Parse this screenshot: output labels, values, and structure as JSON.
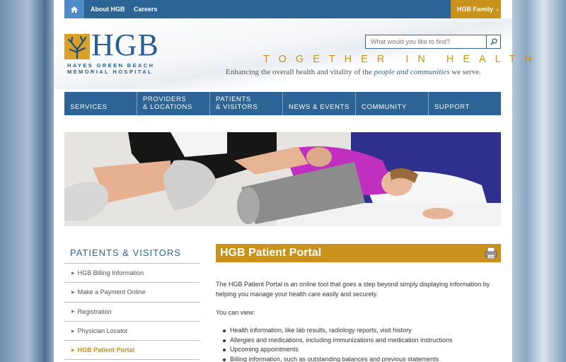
{
  "utility_nav": {
    "about": "About HGB",
    "careers": "Careers",
    "family": "HGB Family",
    "family_arrow": "›"
  },
  "logo": {
    "text": "HGB",
    "subline_1": "HAYES GREEN BEACH",
    "subline_2": "MEMORIAL HOSPITAL"
  },
  "search": {
    "placeholder": "What would you like to find?"
  },
  "tagline": "TOGETHER IN HEALTH",
  "subtagline": {
    "before": "Enhancing the overall health and vitality of the ",
    "emphasis": "people and communities",
    "after": " we serve."
  },
  "main_nav": [
    {
      "line1": "",
      "line2": "SERVICES"
    },
    {
      "line1": "PROVIDERS",
      "line2": "& LOCATIONS"
    },
    {
      "line1": "PATIENTS",
      "line2": "& VISITORS"
    },
    {
      "line1": "",
      "line2": "NEWS & EVENTS"
    },
    {
      "line1": "",
      "line2": "COMMUNITY"
    },
    {
      "line1": "",
      "line2": "SUPPORT"
    }
  ],
  "sidebar": {
    "title": "PATIENTS & VISITORS",
    "items": [
      {
        "label": "HGB Billing Information"
      },
      {
        "label": "Make a Payment Online"
      },
      {
        "label": "Registration"
      },
      {
        "label": "Physician Locator"
      },
      {
        "label": "HGB Patient Portal"
      }
    ]
  },
  "content": {
    "heading": "HGB Patient Portal",
    "intro": "The HGB Patient Portal is an online tool that goes a step beyond simply displaying information by helping you manage your health care easily and securely.",
    "view_label": "You can view:",
    "bullets": [
      "Health information, like lab results, radiology reports, visit history",
      "Allergies and medications, including immunizations and medication instructions",
      "Upcoming appointments",
      "Billing information, such as outstanding balances and previous statements"
    ]
  },
  "colors": {
    "brand_blue": "#2d6496",
    "brand_gold": "#c8921b",
    "home_blue": "#4f8cc7"
  }
}
